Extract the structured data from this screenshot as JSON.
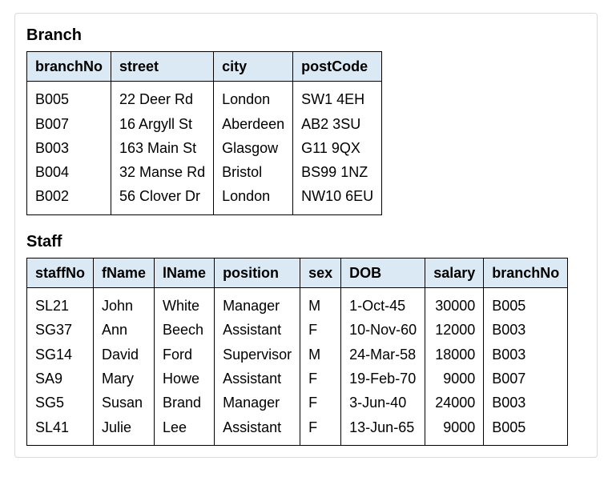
{
  "branch": {
    "title": "Branch",
    "headers": [
      "branchNo",
      "street",
      "city",
      "postCode"
    ],
    "rows": [
      [
        "B005",
        "22 Deer Rd",
        "London",
        "SW1 4EH"
      ],
      [
        "B007",
        "16 Argyll St",
        "Aberdeen",
        "AB2 3SU"
      ],
      [
        "B003",
        "163 Main St",
        "Glasgow",
        "G11 9QX"
      ],
      [
        "B004",
        "32 Manse Rd",
        "Bristol",
        "BS99 1NZ"
      ],
      [
        "B002",
        "56 Clover Dr",
        "London",
        "NW10 6EU"
      ]
    ]
  },
  "staff": {
    "title": "Staff",
    "headers": [
      "staffNo",
      "fName",
      "lName",
      "position",
      "sex",
      "DOB",
      "salary",
      "branchNo"
    ],
    "rows": [
      [
        "SL21",
        "John",
        "White",
        "Manager",
        "M",
        "1-Oct-45",
        "30000",
        "B005"
      ],
      [
        "SG37",
        "Ann",
        "Beech",
        "Assistant",
        "F",
        "10-Nov-60",
        "12000",
        "B003"
      ],
      [
        "SG14",
        "David",
        "Ford",
        "Supervisor",
        "M",
        "24-Mar-58",
        "18000",
        "B003"
      ],
      [
        "SA9",
        "Mary",
        "Howe",
        "Assistant",
        "F",
        "19-Feb-70",
        "9000",
        "B007"
      ],
      [
        "SG5",
        "Susan",
        "Brand",
        "Manager",
        "F",
        "3-Jun-40",
        "24000",
        "B003"
      ],
      [
        "SL41",
        "Julie",
        "Lee",
        "Assistant",
        "F",
        "13-Jun-65",
        "9000",
        "B005"
      ]
    ],
    "numericColumns": [
      6
    ]
  }
}
